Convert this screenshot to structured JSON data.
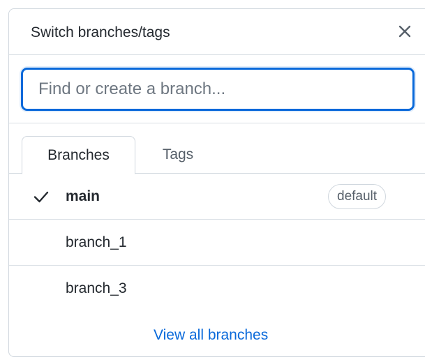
{
  "header": {
    "title": "Switch branches/tags",
    "close_icon": "close-icon"
  },
  "search": {
    "placeholder": "Find or create a branch...",
    "value": ""
  },
  "tabs": [
    {
      "label": "Branches",
      "active": true
    },
    {
      "label": "Tags",
      "active": false
    }
  ],
  "branches": [
    {
      "name": "main",
      "current": true,
      "badge": "default",
      "icon": "check-icon"
    },
    {
      "name": "branch_1",
      "current": false
    },
    {
      "name": "branch_3",
      "current": false
    }
  ],
  "footer": {
    "view_all_label": "View all branches"
  },
  "colors": {
    "accent": "#0969da",
    "border": "#d0d7de",
    "text": "#24292f",
    "muted": "#57606a"
  }
}
